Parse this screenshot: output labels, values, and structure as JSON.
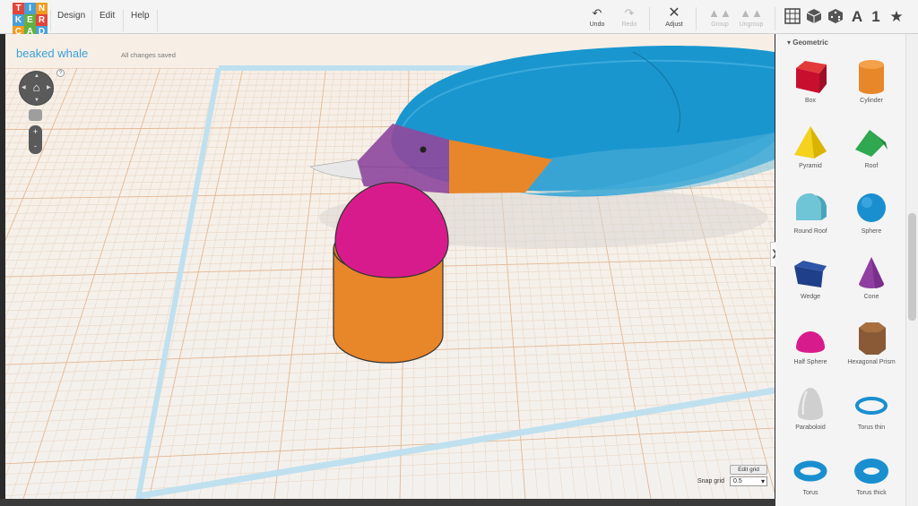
{
  "logo": {
    "letters": [
      "T",
      "I",
      "N",
      "K",
      "E",
      "R",
      "C",
      "A",
      "D"
    ],
    "colors": [
      "#e2453a",
      "#4aa0d6",
      "#f29a1f",
      "#4aa0d6",
      "#63b041",
      "#e2453a",
      "#f29a1f",
      "#63b041",
      "#4aa0d6"
    ]
  },
  "menu": {
    "design": "Design",
    "edit": "Edit",
    "help": "Help"
  },
  "toolbar": {
    "undo": "Undo",
    "redo": "Redo",
    "adjust": "Adjust",
    "group": "Group",
    "ungroup": "Ungroup"
  },
  "right_tools": {
    "text_icon": "A",
    "number_icon": "1",
    "star_icon": "★"
  },
  "design": {
    "title": "beaked whale",
    "status": "All changes saved"
  },
  "view": {
    "help": "?",
    "zoom_in": "+",
    "zoom_out": "-"
  },
  "grid": {
    "edit_label": "Edit grid",
    "snap_label": "Snap grid",
    "snap_value": "0.5"
  },
  "panel": {
    "category": "Geometric",
    "shapes": [
      {
        "label": "Box"
      },
      {
        "label": "Cylinder"
      },
      {
        "label": "Pyramid"
      },
      {
        "label": "Roof"
      },
      {
        "label": "Round Roof"
      },
      {
        "label": "Sphere"
      },
      {
        "label": "Wedge"
      },
      {
        "label": "Cone"
      },
      {
        "label": "Half Sphere"
      },
      {
        "label": "Hexagonal Prism"
      },
      {
        "label": "Paraboloid"
      },
      {
        "label": "Torus thin"
      },
      {
        "label": "Torus"
      },
      {
        "label": "Torus thick"
      }
    ]
  },
  "colors": {
    "accent": "#3aa0d8",
    "whale": "#1a96cf",
    "beak": "#8e4a9e",
    "orange": "#e8862a",
    "magenta": "#d81b8c"
  }
}
